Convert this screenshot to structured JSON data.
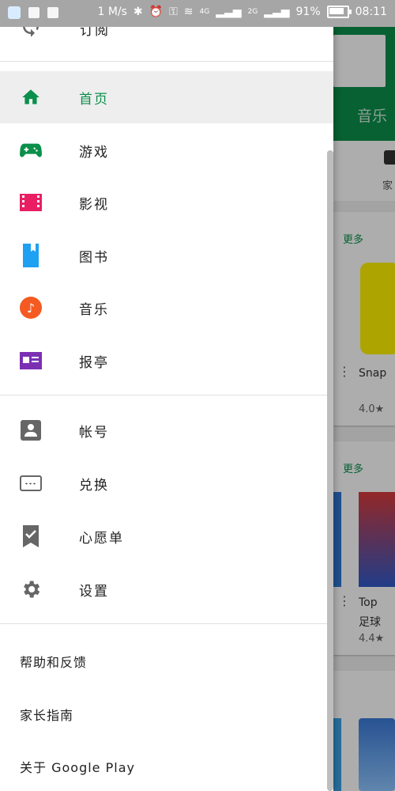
{
  "status_bar": {
    "speed": "1 M/s",
    "signal1": "4G",
    "signal2": "2G",
    "battery_text": "91%",
    "battery_level": 0.91,
    "time": "08:11"
  },
  "background": {
    "tab_label": "音乐",
    "subtab_label": "家",
    "more1": "更多",
    "more2": "更多",
    "app1_name": "Snap",
    "app1_rating": "4.0★",
    "app2_name": "Top",
    "app2_sub": "足球",
    "app2_rating": "4.4★"
  },
  "drawer": {
    "top_item": {
      "label": "订阅",
      "icon": "sync-icon"
    },
    "primary": [
      {
        "label": "首页",
        "icon": "home-icon",
        "active": true,
        "color": "#0b8f4b"
      },
      {
        "label": "游戏",
        "icon": "gamepad-icon",
        "color": "#0b8f4b"
      },
      {
        "label": "影视",
        "icon": "movie-icon",
        "color": "#e91e63"
      },
      {
        "label": "图书",
        "icon": "book-icon",
        "color": "#1ea1f2"
      },
      {
        "label": "音乐",
        "icon": "music-icon",
        "color": "#f45a21"
      },
      {
        "label": "报亭",
        "icon": "newsstand-icon",
        "color": "#7b2fb3"
      }
    ],
    "secondary": [
      {
        "label": "帐号",
        "icon": "account-icon"
      },
      {
        "label": "兑换",
        "icon": "redeem-icon"
      },
      {
        "label": "心愿单",
        "icon": "wishlist-icon"
      },
      {
        "label": "设置",
        "icon": "gear-icon"
      }
    ],
    "footer": [
      {
        "label": "帮助和反馈"
      },
      {
        "label": "家长指南"
      },
      {
        "label": "关于 Google Play"
      }
    ]
  }
}
